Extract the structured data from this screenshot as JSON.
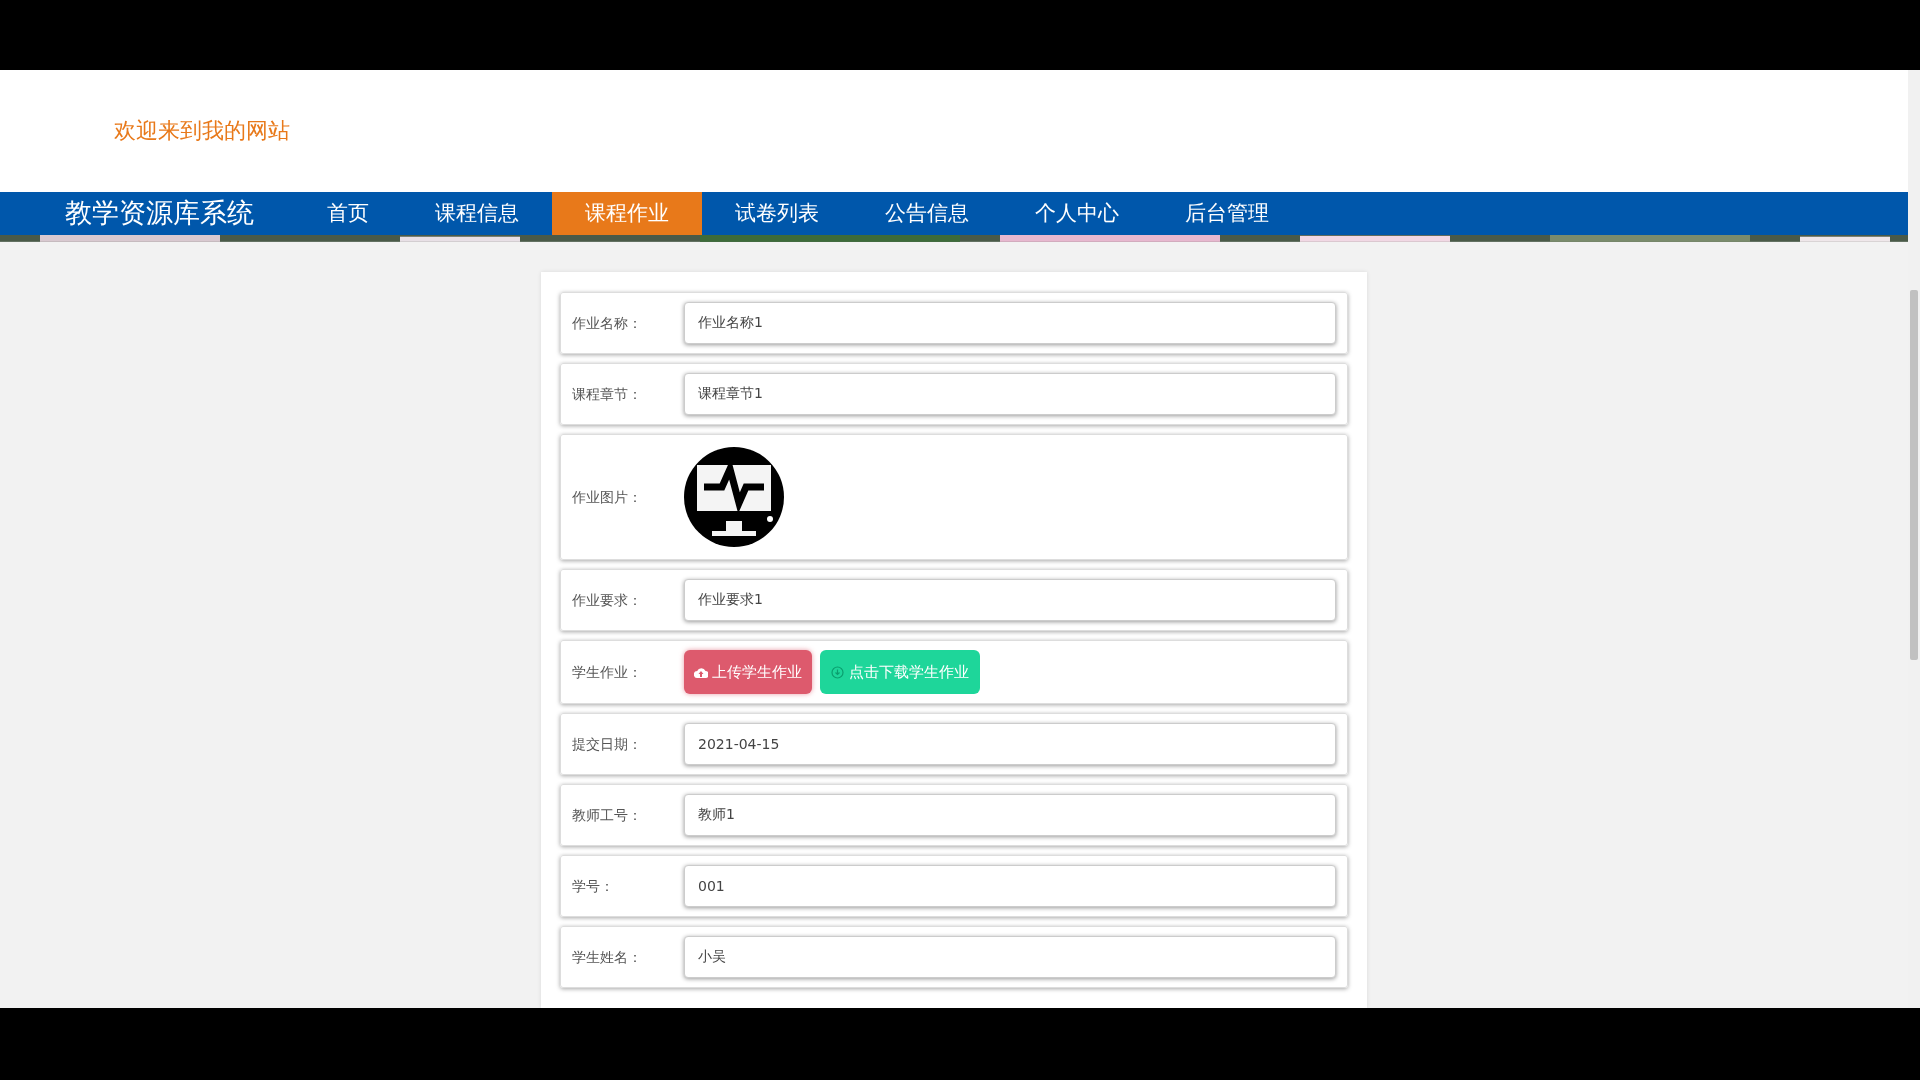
{
  "header": {
    "welcome": "欢迎来到我的网站"
  },
  "nav": {
    "brand": "教学资源库系统",
    "items": [
      {
        "label": "首页",
        "selected": false
      },
      {
        "label": "课程信息",
        "selected": false
      },
      {
        "label": "课程作业",
        "selected": true
      },
      {
        "label": "试卷列表",
        "selected": false
      },
      {
        "label": "公告信息",
        "selected": false
      },
      {
        "label": "个人中心",
        "selected": false
      },
      {
        "label": "后台管理",
        "selected": false
      }
    ]
  },
  "form": {
    "rows": [
      {
        "kind": "field",
        "label": "作业名称：",
        "value": "作业名称1"
      },
      {
        "kind": "field",
        "label": "课程章节：",
        "value": "课程章节1"
      },
      {
        "label": "作业图片："
      },
      {
        "kind": "field",
        "label": "作业要求：",
        "value": "作业要求1"
      },
      {
        "kind": "buttons",
        "label": "学生作业：",
        "buttons": [
          {
            "kind": "upload",
            "label": "上传学生作业"
          },
          {
            "kind": "download",
            "label": "点击下载学生作业"
          }
        ]
      },
      {
        "kind": "field",
        "label": "提交日期：",
        "value": "2021-04-15"
      },
      {
        "kind": "field",
        "label": "教师工号：",
        "value": "教师1"
      },
      {
        "kind": "field",
        "label": "学号：",
        "value": "001"
      },
      {
        "kind": "field",
        "label": "学生姓名：",
        "value": "小吴"
      }
    ]
  }
}
